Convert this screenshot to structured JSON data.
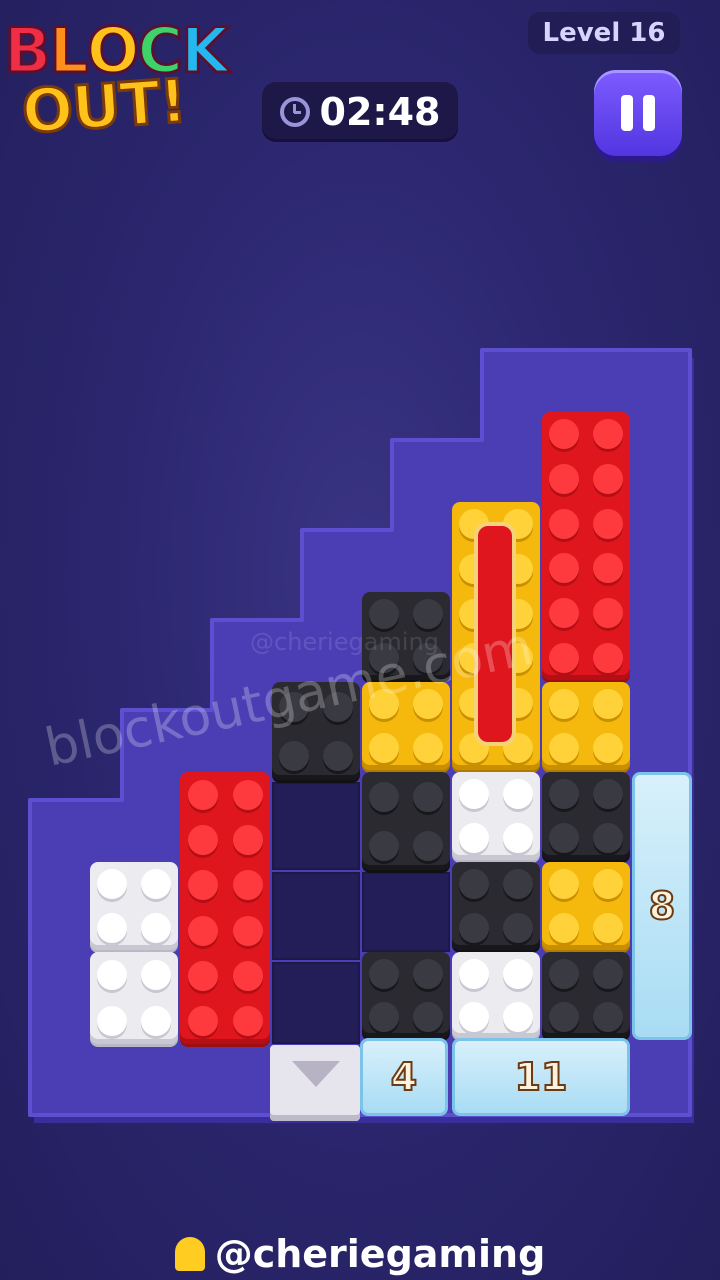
{
  "header": {
    "logo_line1": "BLOCK",
    "logo_line2": "OUT!",
    "level_label": "Level 16",
    "timer": "02:48",
    "clock_icon": "clock-icon",
    "pause_icon": "pause-icon"
  },
  "ice_counters": {
    "right": "8",
    "bottom_left": "4",
    "bottom_right": "11"
  },
  "watermarks": {
    "site": "blockoutgame.com",
    "handle_faint": "@cheriegaming"
  },
  "footer": {
    "handle": "@cheriegaming",
    "bell_icon": "bell-icon"
  },
  "colors": {
    "background": "#2a2468",
    "board": "#4b3eb5",
    "red": "#e0161e",
    "yellow": "#f5b80c",
    "black": "#2a2a30",
    "white": "#ececf0",
    "pause_button": "#6a48f0"
  }
}
